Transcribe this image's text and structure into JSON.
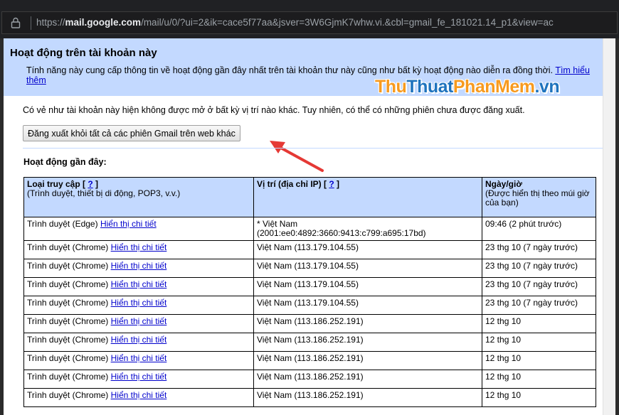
{
  "browser": {
    "url_prefix": "https://",
    "url_host": "mail.google.com",
    "url_path": "/mail/u/0/?ui=2&ik=cace5f77aa&jsver=3W6GjmK7whw.vi.&cbl=gmail_fe_181021.14_p1&view=ac"
  },
  "panel": {
    "title": "Hoạt động trên tài khoản này",
    "description": "Tính năng này cung cấp thông tin về hoạt động gần đây nhất trên tài khoản thư này cũng như bất kỳ hoạt động nào diễn ra đồng thời.",
    "learn_more": "Tìm hiểu thêm"
  },
  "watermark": {
    "part1": "Thu",
    "part2": "Thuat",
    "part3": "PhanMem",
    "part4": ".vn"
  },
  "notice": "Có vẻ như tài khoản này hiện không được mở ở bất kỳ vị trí nào khác. Tuy nhiên, có thể có những phiên chưa được đăng xuất.",
  "signout_button": "Đăng xuất khỏi tất cả các phiên Gmail trên web khác",
  "recent_label": "Hoạt động gần đây:",
  "table": {
    "col_access_title": "Loại truy cập",
    "col_access_help": "?",
    "col_access_sub": "(Trình duyệt, thiết bị di động, POP3, v.v.)",
    "col_location_title": "Vị trí (địa chỉ IP)",
    "col_location_help": "?",
    "col_date_title": "Ngày/giờ",
    "col_date_sub": "(Được hiển thị theo múi giờ của bạn)",
    "detail_link": "Hiển thị chi tiết",
    "rows": [
      {
        "access": "Trình duyệt (Edge)",
        "location_line1": "* Việt Nam",
        "location_line2": "(2001:ee0:4892:3660:9413:c799:a695:17bd)",
        "date": "09:46 (2 phút trước)"
      },
      {
        "access": "Trình duyệt (Chrome)",
        "location_line1": "Việt Nam (113.179.104.55)",
        "location_line2": "",
        "date": "23 thg 10 (7 ngày trước)"
      },
      {
        "access": "Trình duyệt (Chrome)",
        "location_line1": "Việt Nam (113.179.104.55)",
        "location_line2": "",
        "date": "23 thg 10 (7 ngày trước)"
      },
      {
        "access": "Trình duyệt (Chrome)",
        "location_line1": "Việt Nam (113.179.104.55)",
        "location_line2": "",
        "date": "23 thg 10 (7 ngày trước)"
      },
      {
        "access": "Trình duyệt (Chrome)",
        "location_line1": "Việt Nam (113.179.104.55)",
        "location_line2": "",
        "date": "23 thg 10 (7 ngày trước)"
      },
      {
        "access": "Trình duyệt (Chrome)",
        "location_line1": "Việt Nam (113.186.252.191)",
        "location_line2": "",
        "date": "12 thg 10"
      },
      {
        "access": "Trình duyệt (Chrome)",
        "location_line1": "Việt Nam (113.186.252.191)",
        "location_line2": "",
        "date": "12 thg 10"
      },
      {
        "access": "Trình duyệt (Chrome)",
        "location_line1": "Việt Nam (113.186.252.191)",
        "location_line2": "",
        "date": "12 thg 10"
      },
      {
        "access": "Trình duyệt (Chrome)",
        "location_line1": "Việt Nam (113.186.252.191)",
        "location_line2": "",
        "date": "12 thg 10"
      },
      {
        "access": "Trình duyệt (Chrome)",
        "location_line1": "Việt Nam (113.186.252.191)",
        "location_line2": "",
        "date": "12 thg 10"
      }
    ]
  },
  "colors": {
    "header_bg": "#c3d9ff",
    "link": "#0000cc",
    "arrow": "#e53935",
    "watermark_orange": "#f79a1e",
    "watermark_blue": "#1e73be"
  }
}
